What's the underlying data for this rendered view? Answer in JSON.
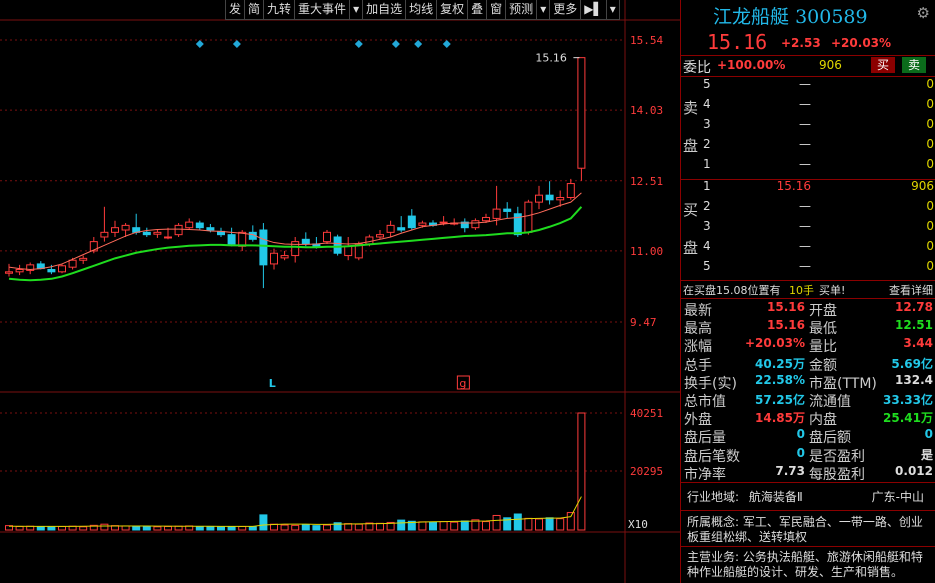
{
  "toolbar": [
    "发",
    "简",
    "九转",
    "重大事件",
    "▾",
    "加自选",
    "均线",
    "复权",
    "叠",
    "窗",
    "预测",
    "▾",
    "更多",
    "▶▌",
    "▾"
  ],
  "stock": {
    "name": "江龙船艇",
    "code": "300589",
    "price": "15.16",
    "change": "+2.53",
    "change_pct": "+20.03%"
  },
  "weibi": {
    "label": "委比",
    "pct": "+100.00%",
    "diff": "906",
    "sell_btn": "买",
    "buy_btn": "卖"
  },
  "sell_side_label": [
    "卖",
    "盘"
  ],
  "buy_side_label": [
    "买",
    "盘"
  ],
  "sell_orders": [
    {
      "lvl": "5",
      "price": "—",
      "vol": "0"
    },
    {
      "lvl": "4",
      "price": "—",
      "vol": "0"
    },
    {
      "lvl": "3",
      "price": "—",
      "vol": "0"
    },
    {
      "lvl": "2",
      "price": "—",
      "vol": "0"
    },
    {
      "lvl": "1",
      "price": "—",
      "vol": "0"
    }
  ],
  "buy_orders": [
    {
      "lvl": "1",
      "price": "15.16",
      "vol": "906"
    },
    {
      "lvl": "2",
      "price": "—",
      "vol": "0"
    },
    {
      "lvl": "3",
      "price": "—",
      "vol": "0"
    },
    {
      "lvl": "4",
      "price": "—",
      "vol": "0"
    },
    {
      "lvl": "5",
      "price": "—",
      "vol": "0"
    }
  ],
  "notice": {
    "text_a": "在买盘15.08位置有",
    "text_b": "10手",
    "text_c": "买单!",
    "detail": "查看详细"
  },
  "stats": [
    {
      "l": "最新",
      "lv": "15.16",
      "lc": "red",
      "r": "开盘",
      "rv": "12.78",
      "rc": "red"
    },
    {
      "l": "最高",
      "lv": "15.16",
      "lc": "red",
      "r": "最低",
      "rv": "12.51",
      "rc": "green"
    },
    {
      "l": "涨幅",
      "lv": "+20.03%",
      "lc": "red",
      "r": "量比",
      "rv": "3.44",
      "rc": "red"
    },
    {
      "l": "总手",
      "lv": "40.25万",
      "lc": "cyan",
      "r": "金额",
      "rv": "5.69亿",
      "rc": "cyan"
    },
    {
      "l": "换手(实)",
      "lv": "22.58%",
      "lc": "cyan",
      "r": "市盈(TTM)",
      "rv": "132.4",
      "rc": "white"
    },
    {
      "l": "总市值",
      "lv": "57.25亿",
      "lc": "cyan",
      "r": "流通值",
      "rv": "33.33亿",
      "rc": "cyan"
    },
    {
      "l": "外盘",
      "lv": "14.85万",
      "lc": "red",
      "r": "内盘",
      "rv": "25.41万",
      "rc": "green"
    },
    {
      "l": "盘后量",
      "lv": "0",
      "lc": "cyan",
      "r": "盘后额",
      "rv": "0",
      "rc": "cyan"
    },
    {
      "l": "盘后笔数",
      "lv": "0",
      "lc": "cyan",
      "r": "是否盈利",
      "rv": "是",
      "rc": "white"
    },
    {
      "l": "市净率",
      "lv": "7.73",
      "lc": "white",
      "r": "每股盈利",
      "rv": "0.012",
      "rc": "white"
    }
  ],
  "industry": {
    "label": "行业地域:",
    "value": "航海装备Ⅱ",
    "region": "广东-中山"
  },
  "concepts": {
    "label": "所属概念:",
    "value": "军工、军民融合、一带一路、创业板重组松绑、送转填权"
  },
  "business": {
    "label": "主营业务:",
    "value": "公务执法船艇、旅游休闲船艇和特种作业船艇的设计、研发、生产和销售。"
  },
  "chart_data": {
    "type": "candlestick",
    "price_axis_labels": [
      "15.54",
      "14.03",
      "12.51",
      "11.00",
      "9.47"
    ],
    "price_ylim": [
      9.47,
      15.54
    ],
    "last_price_label": "15.16",
    "volume_axis_labels": [
      "40251",
      "20295",
      "X10"
    ],
    "volume_ylim": [
      0,
      40251
    ],
    "markers": [
      "L",
      "g"
    ],
    "colors": {
      "up": "#ff3b3b",
      "down": "#22c8e8",
      "ma_slow": "#1fdc1f",
      "ma_fast": "#ff6b5a",
      "vol_ma": "#e0d700",
      "grid": "#7a1010"
    },
    "candles": [
      {
        "o": 10.52,
        "h": 10.72,
        "l": 10.45,
        "c": 10.55
      },
      {
        "o": 10.55,
        "h": 10.7,
        "l": 10.48,
        "c": 10.6
      },
      {
        "o": 10.58,
        "h": 10.75,
        "l": 10.5,
        "c": 10.7
      },
      {
        "o": 10.72,
        "h": 10.78,
        "l": 10.6,
        "c": 10.62
      },
      {
        "o": 10.6,
        "h": 10.7,
        "l": 10.5,
        "c": 10.55
      },
      {
        "o": 10.55,
        "h": 10.72,
        "l": 10.52,
        "c": 10.68
      },
      {
        "o": 10.65,
        "h": 10.85,
        "l": 10.6,
        "c": 10.8
      },
      {
        "o": 10.8,
        "h": 10.9,
        "l": 10.72,
        "c": 10.84
      },
      {
        "o": 11.0,
        "h": 11.3,
        "l": 10.95,
        "c": 11.2
      },
      {
        "o": 11.3,
        "h": 11.95,
        "l": 11.2,
        "c": 11.4
      },
      {
        "o": 11.4,
        "h": 11.65,
        "l": 11.3,
        "c": 11.5
      },
      {
        "o": 11.45,
        "h": 11.6,
        "l": 11.3,
        "c": 11.55
      },
      {
        "o": 11.5,
        "h": 11.8,
        "l": 11.35,
        "c": 11.4
      },
      {
        "o": 11.4,
        "h": 11.5,
        "l": 11.3,
        "c": 11.35
      },
      {
        "o": 11.36,
        "h": 11.45,
        "l": 11.28,
        "c": 11.4
      },
      {
        "o": 11.3,
        "h": 11.5,
        "l": 11.25,
        "c": 11.3
      },
      {
        "o": 11.35,
        "h": 11.6,
        "l": 11.3,
        "c": 11.55
      },
      {
        "o": 11.5,
        "h": 11.7,
        "l": 11.45,
        "c": 11.62
      },
      {
        "o": 11.6,
        "h": 11.65,
        "l": 11.45,
        "c": 11.5
      },
      {
        "o": 11.5,
        "h": 11.58,
        "l": 11.4,
        "c": 11.45
      },
      {
        "o": 11.42,
        "h": 11.5,
        "l": 11.3,
        "c": 11.35
      },
      {
        "o": 11.35,
        "h": 11.5,
        "l": 11.1,
        "c": 11.15
      },
      {
        "o": 11.1,
        "h": 11.45,
        "l": 11.0,
        "c": 11.4
      },
      {
        "o": 11.4,
        "h": 11.55,
        "l": 11.2,
        "c": 11.25
      },
      {
        "o": 11.45,
        "h": 11.6,
        "l": 10.2,
        "c": 10.7
      },
      {
        "o": 10.72,
        "h": 11.05,
        "l": 10.6,
        "c": 10.95
      },
      {
        "o": 10.85,
        "h": 11.0,
        "l": 10.8,
        "c": 10.9
      },
      {
        "o": 10.9,
        "h": 11.3,
        "l": 10.75,
        "c": 11.2
      },
      {
        "o": 11.25,
        "h": 11.4,
        "l": 11.1,
        "c": 11.15
      },
      {
        "o": 11.15,
        "h": 11.3,
        "l": 11.05,
        "c": 11.1
      },
      {
        "o": 11.2,
        "h": 11.45,
        "l": 11.15,
        "c": 11.4
      },
      {
        "o": 11.3,
        "h": 11.35,
        "l": 10.9,
        "c": 10.95
      },
      {
        "o": 10.9,
        "h": 11.3,
        "l": 10.8,
        "c": 11.1
      },
      {
        "o": 10.85,
        "h": 11.2,
        "l": 10.8,
        "c": 11.15
      },
      {
        "o": 11.15,
        "h": 11.35,
        "l": 11.1,
        "c": 11.3
      },
      {
        "o": 11.3,
        "h": 11.45,
        "l": 11.25,
        "c": 11.35
      },
      {
        "o": 11.4,
        "h": 11.65,
        "l": 11.3,
        "c": 11.55
      },
      {
        "o": 11.5,
        "h": 11.75,
        "l": 11.4,
        "c": 11.45
      },
      {
        "o": 11.75,
        "h": 11.9,
        "l": 11.45,
        "c": 11.5
      },
      {
        "o": 11.55,
        "h": 11.65,
        "l": 11.5,
        "c": 11.6
      },
      {
        "o": 11.6,
        "h": 11.66,
        "l": 11.52,
        "c": 11.55
      },
      {
        "o": 11.6,
        "h": 11.75,
        "l": 11.55,
        "c": 11.62
      },
      {
        "o": 11.58,
        "h": 11.7,
        "l": 11.55,
        "c": 11.6
      },
      {
        "o": 11.62,
        "h": 11.7,
        "l": 11.4,
        "c": 11.5
      },
      {
        "o": 11.5,
        "h": 11.7,
        "l": 11.45,
        "c": 11.65
      },
      {
        "o": 11.65,
        "h": 11.8,
        "l": 11.6,
        "c": 11.72
      },
      {
        "o": 11.7,
        "h": 12.4,
        "l": 11.55,
        "c": 11.9
      },
      {
        "o": 11.9,
        "h": 12.05,
        "l": 11.7,
        "c": 11.85
      },
      {
        "o": 11.8,
        "h": 11.95,
        "l": 11.3,
        "c": 11.35
      },
      {
        "o": 11.4,
        "h": 12.1,
        "l": 11.35,
        "c": 12.05
      },
      {
        "o": 12.05,
        "h": 12.4,
        "l": 11.9,
        "c": 12.2
      },
      {
        "o": 12.2,
        "h": 12.5,
        "l": 12.0,
        "c": 12.1
      },
      {
        "o": 12.1,
        "h": 12.3,
        "l": 11.95,
        "c": 12.15
      },
      {
        "o": 12.15,
        "h": 12.55,
        "l": 12.1,
        "c": 12.45
      },
      {
        "o": 12.78,
        "h": 15.16,
        "l": 12.51,
        "c": 15.16
      }
    ],
    "ma_slow": [
      10.4,
      10.38,
      10.37,
      10.38,
      10.4,
      10.45,
      10.52,
      10.6,
      10.68,
      10.76,
      10.84,
      10.9,
      10.96,
      11.0,
      11.04,
      11.07,
      11.09,
      11.11,
      11.12,
      11.13,
      11.13,
      11.12,
      11.12,
      11.12,
      11.11,
      11.1,
      11.09,
      11.09,
      11.08,
      11.08,
      11.09,
      11.09,
      11.1,
      11.12,
      11.14,
      11.16,
      11.18,
      11.2,
      11.22,
      11.24,
      11.26,
      11.28,
      11.3,
      11.32,
      11.33,
      11.34,
      11.36,
      11.38,
      11.38,
      11.4,
      11.45,
      11.52,
      11.6,
      11.7,
      11.95
    ],
    "ma_fast": [
      10.65,
      10.62,
      10.6,
      10.62,
      10.66,
      10.72,
      10.82,
      10.92,
      11.02,
      11.12,
      11.22,
      11.32,
      11.4,
      11.44,
      11.46,
      11.47,
      11.47,
      11.46,
      11.45,
      11.43,
      11.42,
      11.4,
      11.38,
      11.35,
      11.25,
      11.18,
      11.15,
      11.14,
      11.14,
      11.15,
      11.17,
      11.16,
      11.15,
      11.16,
      11.2,
      11.25,
      11.3,
      11.38,
      11.45,
      11.52,
      11.55,
      11.58,
      11.6,
      11.6,
      11.6,
      11.62,
      11.66,
      11.7,
      11.72,
      11.76,
      11.82,
      11.9,
      11.98,
      12.05,
      12.25
    ],
    "volumes": [
      1500,
      1200,
      1300,
      1100,
      1000,
      1200,
      1300,
      1100,
      1600,
      2000,
      1500,
      1400,
      1300,
      1200,
      1100,
      1200,
      1300,
      1400,
      1200,
      1100,
      1000,
      1100,
      1200,
      1100,
      5200,
      2000,
      1700,
      1600,
      1800,
      1500,
      1700,
      2500,
      2200,
      2000,
      2400,
      2300,
      2600,
      3400,
      3000,
      2800,
      2600,
      2900,
      2700,
      3100,
      3500,
      2900,
      5000,
      4200,
      5500,
      4000,
      3800,
      4200,
      3900,
      6000,
      40251
    ],
    "volume_ma": [
      1300,
      1280,
      1260,
      1240,
      1230,
      1240,
      1260,
      1290,
      1320,
      1360,
      1380,
      1390,
      1380,
      1360,
      1340,
      1320,
      1300,
      1290,
      1280,
      1270,
      1260,
      1250,
      1250,
      1250,
      1700,
      1900,
      2000,
      2000,
      2000,
      1950,
      1950,
      2000,
      2050,
      2100,
      2150,
      2200,
      2300,
      2450,
      2600,
      2750,
      2850,
      2900,
      2950,
      3000,
      3050,
      3100,
      3300,
      3500,
      3700,
      3900,
      4000,
      4100,
      4100,
      4600,
      11500
    ]
  }
}
